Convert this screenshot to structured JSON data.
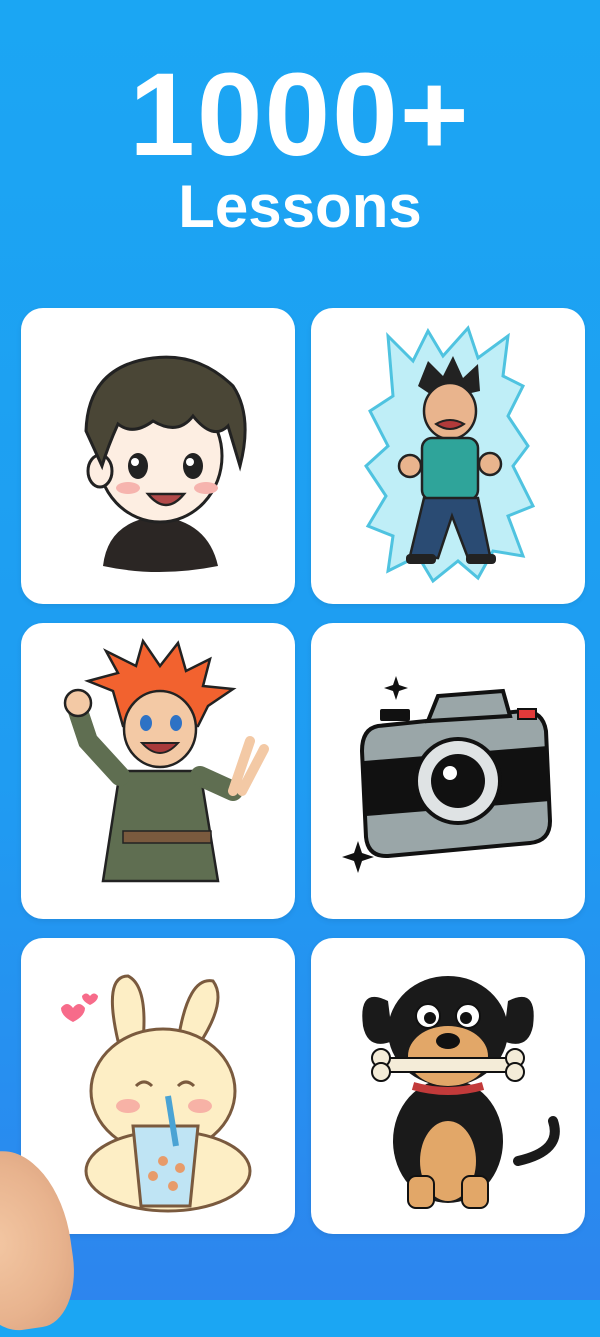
{
  "hero": {
    "number": "1000+",
    "label": "Lessons"
  },
  "lessons": [
    {
      "icon": "boy-face-icon"
    },
    {
      "icon": "powered-up-fighter-icon"
    },
    {
      "icon": "orange-hair-hero-icon"
    },
    {
      "icon": "camera-icon"
    },
    {
      "icon": "bunny-bubble-tea-icon"
    },
    {
      "icon": "dog-with-bone-icon"
    }
  ],
  "colors": {
    "background_top": "#1ba6f3",
    "background_bottom": "#2d85ee",
    "card": "#ffffff",
    "text": "#ffffff"
  }
}
